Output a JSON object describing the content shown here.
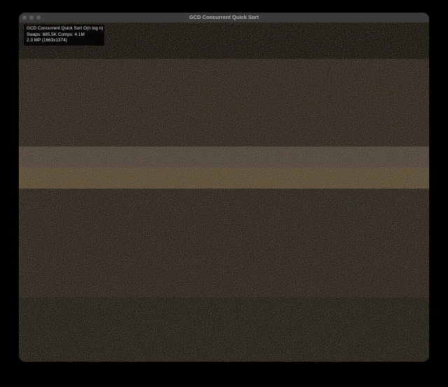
{
  "window": {
    "title": "GCD Concurrent Quick Sort"
  },
  "overlay": {
    "line1": "GCD Concurrent Quick Sort O(n log n)",
    "line2": "Swaps: 685.5K  Comps: 4.1M",
    "line3": "2.3 MP (1663x1374)"
  },
  "colors": {
    "background": "#000000",
    "titlebar": "#3a3a3a",
    "title_text": "#b5b5b5",
    "band_dark": "#1c1a17",
    "band_mid": "#3a332b",
    "band_light": "#6a5c4c",
    "band_gold": "#7d6a4e"
  }
}
